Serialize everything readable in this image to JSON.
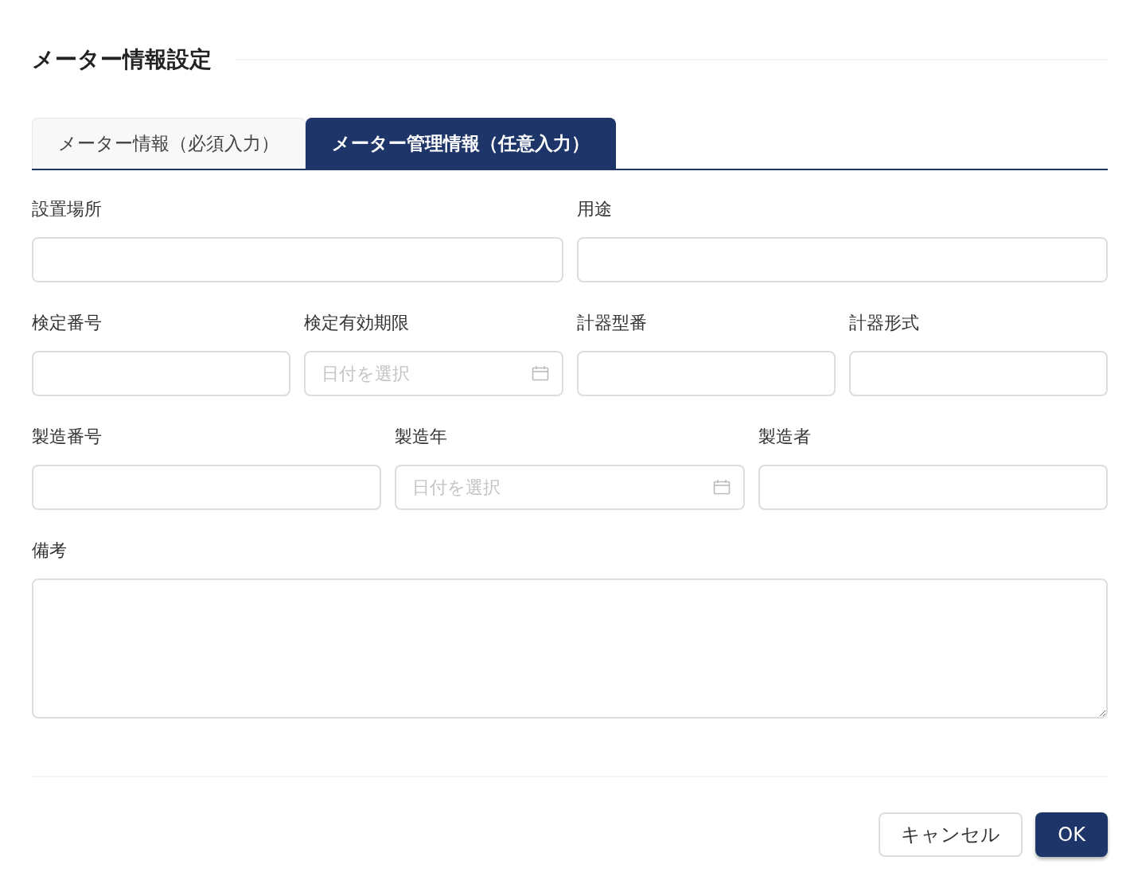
{
  "title": "メーター情報設定",
  "tabs": [
    {
      "label": "メーター情報（必須入力）",
      "selected": false
    },
    {
      "label": "メーター管理情報（任意入力）",
      "selected": true
    }
  ],
  "form_rows": [
    {
      "fields": [
        {
          "label": "設置場所",
          "kind": "text"
        },
        {
          "label": "用途",
          "kind": "text"
        }
      ]
    },
    {
      "fields": [
        {
          "label": "検定番号",
          "kind": "text"
        },
        {
          "label": "検定有効期限",
          "kind": "date",
          "placeholder": "日付を選択"
        },
        {
          "label": "計器型番",
          "kind": "text"
        },
        {
          "label": "計器形式",
          "kind": "text"
        }
      ]
    },
    {
      "fields": [
        {
          "label": "製造番号",
          "kind": "text"
        },
        {
          "label": "製造年",
          "kind": "date",
          "placeholder": "日付を選択"
        },
        {
          "label": "製造者",
          "kind": "text"
        }
      ]
    },
    {
      "fields": [
        {
          "label": "備考",
          "kind": "textarea"
        }
      ]
    }
  ],
  "buttons": [
    {
      "label": "キャンセル",
      "kind": "secondary"
    },
    {
      "label": "OK",
      "kind": "primary"
    }
  ]
}
